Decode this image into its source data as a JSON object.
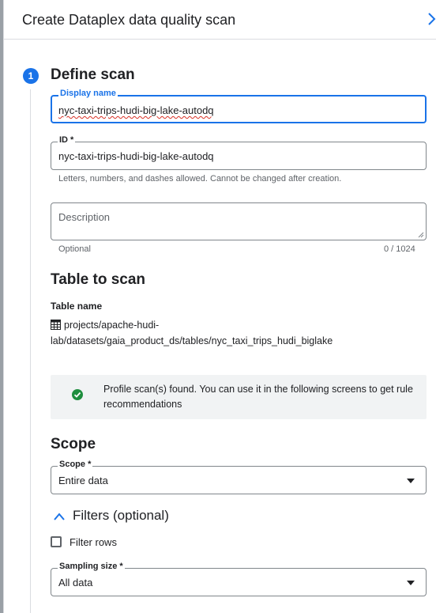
{
  "header": {
    "title": "Create Dataplex data quality scan"
  },
  "step": {
    "number": "1",
    "title": "Define scan"
  },
  "display_name": {
    "label": "Display name",
    "value": "nyc-taxi-trips-hudi-big-lake-autodq"
  },
  "id_field": {
    "label": "ID *",
    "value": "nyc-taxi-trips-hudi-big-lake-autodq",
    "hint": "Letters, numbers, and dashes allowed. Cannot be changed after creation."
  },
  "description": {
    "placeholder": "Description",
    "hint": "Optional",
    "counter": "0 / 1024"
  },
  "table_section": {
    "title": "Table to scan",
    "table_name_label": "Table name",
    "path_line1": "projects/apache-hudi-",
    "path_line2": "lab/datasets/gaia_product_ds/tables/nyc_taxi_trips_hudi_biglake"
  },
  "info": {
    "text": "Profile scan(s) found. You can use it in the following screens to get rule recommendations",
    "status_color": "#1e8e3e"
  },
  "scope_section": {
    "title": "Scope",
    "scope_label": "Scope *",
    "scope_value": "Entire data",
    "filters_label": "Filters (optional)",
    "filter_rows_label": "Filter rows",
    "filter_rows_checked": false,
    "sampling_label": "Sampling size *",
    "sampling_value": "All data"
  },
  "colors": {
    "accent": "#1a73e8",
    "border": "#80868b",
    "info_bg": "#f1f3f4"
  }
}
